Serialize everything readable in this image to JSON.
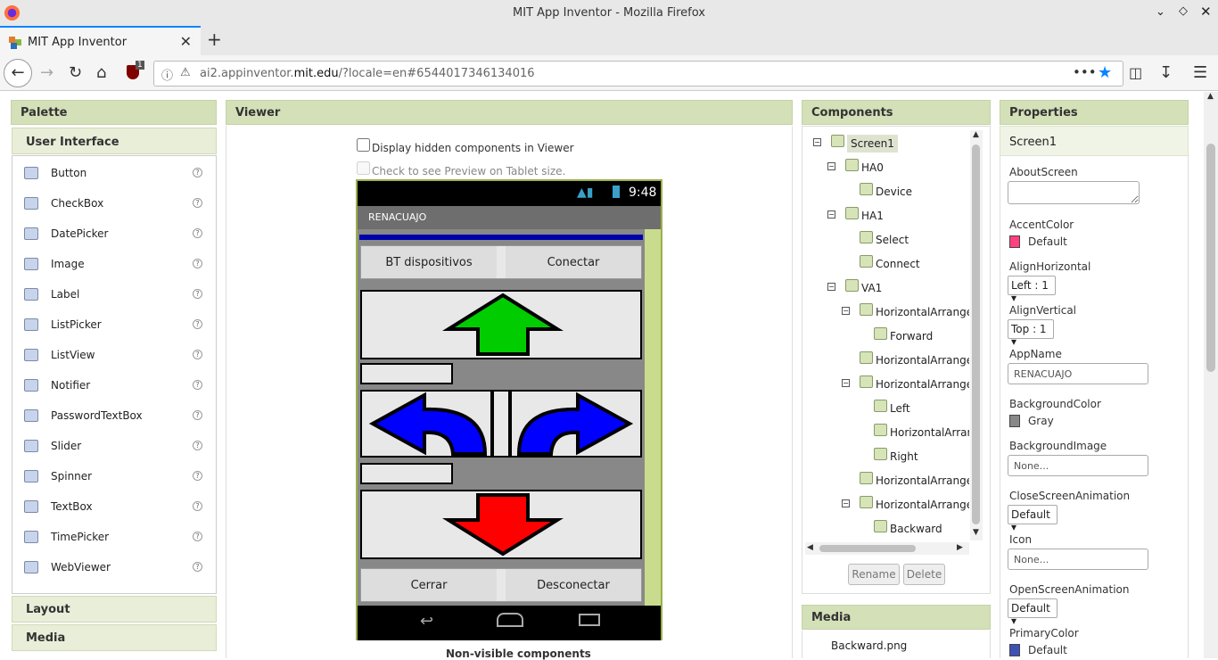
{
  "browser": {
    "window_title": "MIT App Inventor - Mozilla Firefox",
    "tab_title": "MIT App Inventor",
    "url_prefix": "ai2.appinventor.",
    "url_domain": "mit.edu",
    "url_suffix": "/?locale=en#6544017346134016",
    "addon_badge": "1"
  },
  "palette": {
    "title": "Palette",
    "section": "User Interface",
    "items": [
      "Button",
      "CheckBox",
      "DatePicker",
      "Image",
      "Label",
      "ListPicker",
      "ListView",
      "Notifier",
      "PasswordTextBox",
      "Slider",
      "Spinner",
      "TextBox",
      "TimePicker",
      "WebViewer"
    ],
    "help_glyph": "?",
    "footer_sections": [
      "Layout",
      "Media"
    ]
  },
  "viewer": {
    "title": "Viewer",
    "hidden_checkbox_label": "Display hidden components in Viewer",
    "tablet_checkbox_label": "Check to see Preview on Tablet size.",
    "non_visible_label": "Non-visible components",
    "phone": {
      "time": "9:48",
      "app_title": "RENACUAJO",
      "bt_button": "BT dispositivos",
      "connect_button": "Conectar",
      "close_button": "Cerrar",
      "disconnect_button": "Desconectar"
    }
  },
  "components": {
    "title": "Components",
    "tree": [
      {
        "label": "Screen1",
        "level": 0,
        "expander": "⊟"
      },
      {
        "label": "HA0",
        "level": 1,
        "expander": "⊟"
      },
      {
        "label": "Device",
        "level": 2,
        "expander": ""
      },
      {
        "label": "HA1",
        "level": 1,
        "expander": "⊟"
      },
      {
        "label": "Select",
        "level": 2,
        "expander": ""
      },
      {
        "label": "Connect",
        "level": 2,
        "expander": ""
      },
      {
        "label": "VA1",
        "level": 1,
        "expander": "⊟"
      },
      {
        "label": "HorizontalArranger",
        "level": 2,
        "expander": "⊟"
      },
      {
        "label": "Forward",
        "level": 3,
        "expander": ""
      },
      {
        "label": "HorizontalArranger",
        "level": 2,
        "expander": ""
      },
      {
        "label": "HorizontalArranger",
        "level": 2,
        "expander": "⊟"
      },
      {
        "label": "Left",
        "level": 3,
        "expander": ""
      },
      {
        "label": "HorizontalArran",
        "level": 3,
        "expander": ""
      },
      {
        "label": "Right",
        "level": 3,
        "expander": ""
      },
      {
        "label": "HorizontalArranger",
        "level": 2,
        "expander": ""
      },
      {
        "label": "HorizontalArranger",
        "level": 2,
        "expander": "⊟"
      },
      {
        "label": "Backward",
        "level": 3,
        "expander": ""
      }
    ],
    "rename_button": "Rename",
    "delete_button": "Delete"
  },
  "media": {
    "title": "Media",
    "files": [
      "Backward.png"
    ]
  },
  "properties": {
    "title": "Properties",
    "component": "Screen1",
    "about_screen": {
      "label": "AboutScreen",
      "value": ""
    },
    "accent_color": {
      "label": "AccentColor",
      "value": "Default",
      "color": "#ff4081"
    },
    "align_horizontal": {
      "label": "AlignHorizontal",
      "value": "Left : 1"
    },
    "align_vertical": {
      "label": "AlignVertical",
      "value": "Top : 1"
    },
    "app_name": {
      "label": "AppName",
      "value": "RENACUAJO"
    },
    "background_color": {
      "label": "BackgroundColor",
      "value": "Gray",
      "color": "#888888"
    },
    "background_image": {
      "label": "BackgroundImage",
      "value": "None..."
    },
    "close_screen_animation": {
      "label": "CloseScreenAnimation",
      "value": "Default"
    },
    "icon": {
      "label": "Icon",
      "value": "None..."
    },
    "open_screen_animation": {
      "label": "OpenScreenAnimation",
      "value": "Default"
    },
    "primary_color": {
      "label": "PrimaryColor",
      "value": "Default",
      "color": "#3f51b5"
    }
  },
  "colors": {
    "panel_header": "#d4e0b8",
    "phone_frame": "#9ab04a",
    "up_arrow": "#00cc00",
    "side_arrows": "#0000ff",
    "down_arrow": "#ff0000"
  }
}
